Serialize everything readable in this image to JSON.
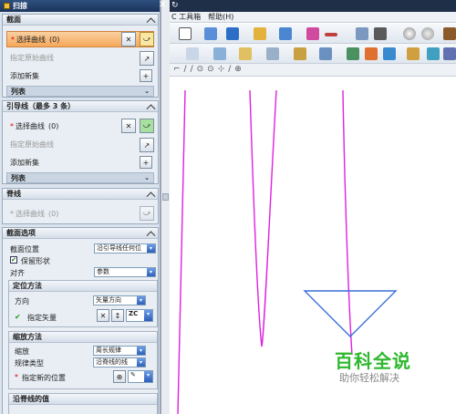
{
  "dialog": {
    "title": "扫掠",
    "section1": {
      "title": "截面",
      "select_curve": "选择曲线",
      "count": "(0)",
      "origin_curve": "指定原始曲线",
      "add_new": "添加新集",
      "list": "列表"
    },
    "section2": {
      "title": "引导线（最多 3 条）",
      "select_curve": "选择曲线",
      "count": "(0)",
      "origin_curve": "指定原始曲线",
      "add_new": "添加新集",
      "list": "列表"
    },
    "section3": {
      "title": "脊线",
      "select_curve": "选择曲线",
      "count": "(0)"
    },
    "section4": {
      "title": "截面选项",
      "position_label": "截面位置",
      "position_value": "沿引导线任何位",
      "keep_shape": "保留形状",
      "align_label": "对齐",
      "align_value": "参数",
      "orient": {
        "title": "定位方法",
        "direction_label": "方向",
        "direction_value": "矢量方向",
        "vector_label": "指定矢量",
        "vector_code": "ZC"
      },
      "scale": {
        "title": "缩放方法",
        "scale_label": "缩放",
        "scale_value": "周长规律",
        "law_label": "规律类型",
        "law_value": "沿脊线的线",
        "new_pos_label": "指定新的位置"
      },
      "spine_value": {
        "title": "沿脊线的值"
      }
    }
  },
  "menubar": {
    "item1": "C 工具箱",
    "item2": "帮助(H)"
  },
  "watermark": {
    "title": "百科全说",
    "subtitle": "助你轻松解决"
  },
  "colors": {
    "curve": "#e020e0",
    "triangle": "#3a6fd8"
  }
}
